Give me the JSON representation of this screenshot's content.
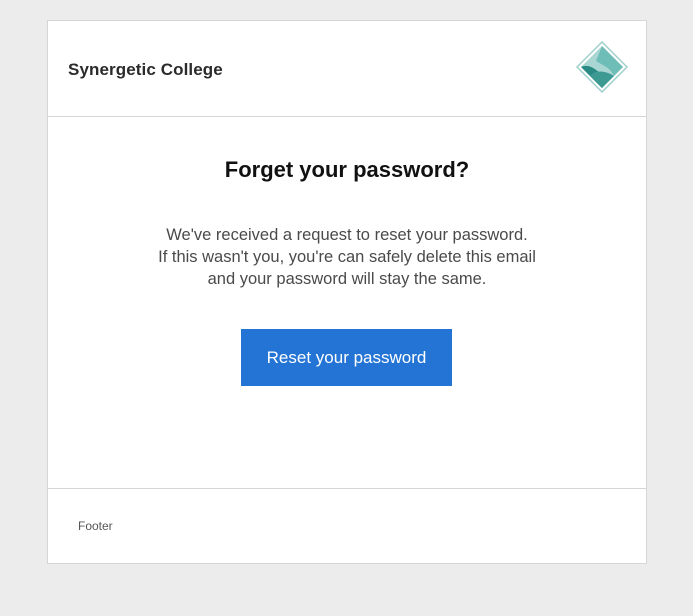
{
  "header": {
    "brand_name": "Synergetic College",
    "logo_icon": "diamond-logo-icon",
    "logo_colors": [
      "#5fb3ad",
      "#2a8a84",
      "#a9d6d2"
    ]
  },
  "main": {
    "title": "Forget your password?",
    "message_lines": [
      "We've received a request to reset your password.",
      "If this wasn't you, you're can safely delete this email",
      "and your password will stay the same."
    ],
    "button_label": "Reset your password",
    "button_color": "#2374d4"
  },
  "footer": {
    "text": "Footer"
  }
}
